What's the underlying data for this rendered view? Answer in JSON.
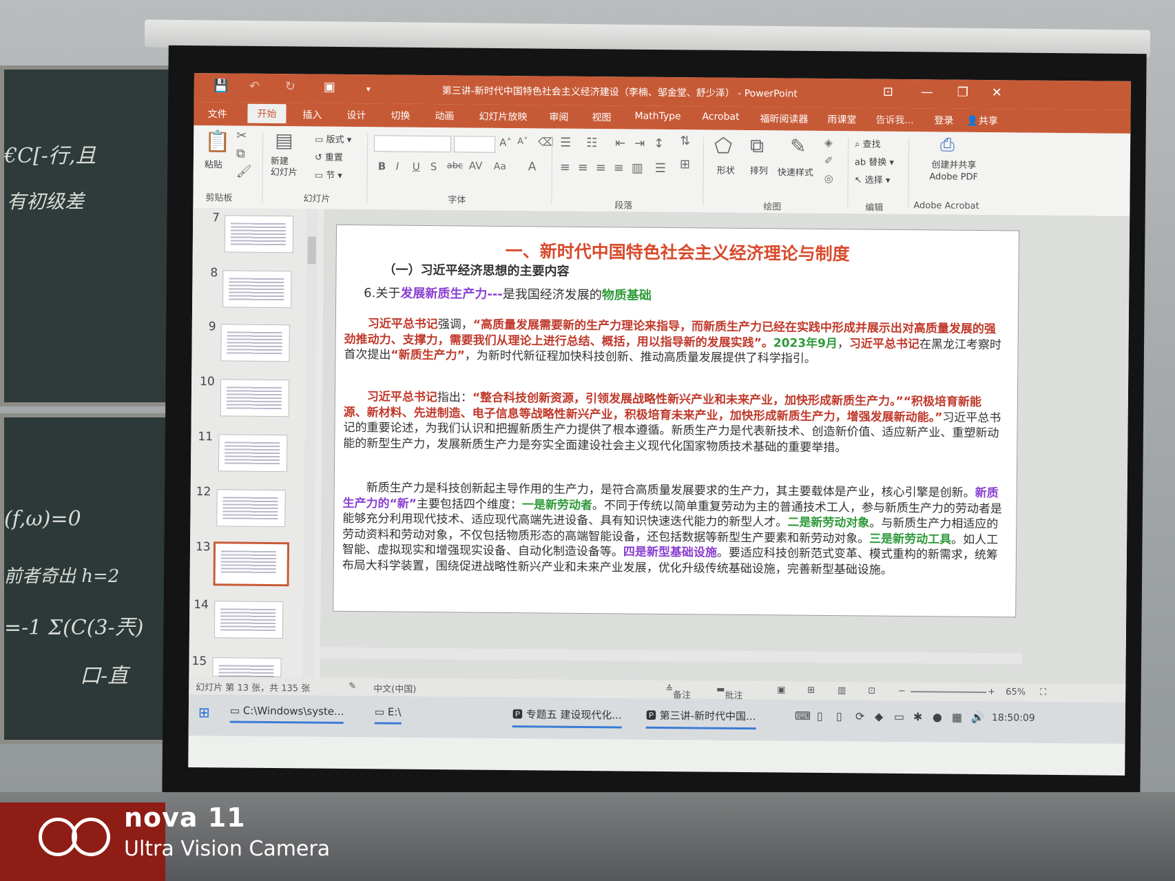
{
  "photo": {
    "camera_brand": "nova 11",
    "camera_sub": "Ultra Vision Camera",
    "chalk_lines": [
      "€C[-行,且",
      "有初级差",
      "(f,ω)=0",
      "前者奇出  h=2",
      "=-1  Σ(C(3-兲)",
      "口-直"
    ]
  },
  "window": {
    "title": "第三讲-新时代中国特色社会主义经济建设（李楠、邹金堂、舒少泽） - PowerPoint",
    "tabs": [
      "文件",
      "开始",
      "插入",
      "设计",
      "切换",
      "动画",
      "幻灯片放映",
      "审阅",
      "视图",
      "MathType",
      "Acrobat",
      "福昕阅读器",
      "雨课堂"
    ],
    "tell_me": "告诉我...",
    "login": "登录",
    "share": "共享"
  },
  "ribbon": {
    "paste": "粘贴",
    "clipboard": "剪贴板",
    "new_slide": "新建\n幻灯片",
    "layout": "版式",
    "reset": "重置",
    "section": "节",
    "slides_group": "幻灯片",
    "font_group": "字体",
    "para_group": "段落",
    "shape": "形状",
    "arrange": "排列",
    "quick_style": "快速样式",
    "draw_group": "绘图",
    "find": "查找",
    "replace": "替换",
    "select": "选择",
    "edit_group": "编辑",
    "create_pdf": "创建并共享\nAdobe PDF",
    "adobe_group": "Adobe Acrobat"
  },
  "thumbnails": [
    "7",
    "8",
    "9",
    "10",
    "11",
    "12",
    "13",
    "14",
    "15"
  ],
  "selected_slide": "13",
  "slide": {
    "title": "一、新时代中国特色社会主义经济理论与制度",
    "subtitle": "（一）习近平经济思想的主要内容",
    "point_prefix": "6.关于",
    "point_highlight": "发展新质生产力---",
    "point_mid": "是我国经济发展的",
    "point_end": "物质基础",
    "p1_a": "习近平总书记",
    "p1_b": "强调，",
    "p1_c": "“高质量发展需要新的生产力理论来指导，而新质生产力已经在实践中形成并展示出对高质量发展的强劲推动力、支撑力，需要我们从理论上进行总结、概括，用以指导新的发展实践”。",
    "p1_d": "2023年9月",
    "p1_e": "，",
    "p1_f": "习近平总书记",
    "p1_g": "在黑龙江考察时首次提出",
    "p1_h": "“新质生产力”",
    "p1_i": "，为新时代新征程加快科技创新、推动高质量发展提供了科学指引。",
    "p2_a": "习近平总书记",
    "p2_b": "指出：",
    "p2_c": "“整合科技创新资源，引领发展战略性新兴产业和未来产业，加快形成新质生产力。”“积极培育新能源、新材料、先进制造、电子信息等战略性新兴产业，积极培育未来产业，加快形成新质生产力，增强发展新动能。”",
    "p2_d": "习近平总书记的重要论述，为我们认识和把握新质生产力提供了根本遵循。新质生产力是代表新技术、创造新价值、适应新产业、重塑新动能的新型生产力，发展新质生产力是夯实全面建设社会主义现代化国家物质技术基础的重要举措。",
    "p3_a": "新质生产力是科技创新起主导作用的生产力，是符合高质量发展要求的生产力，其主要载体是产业，核心引擎是创新。",
    "p3_b": "新质生产力的“新”",
    "p3_c": "主要包括四个维度：",
    "p3_d": "一是新劳动者",
    "p3_e": "。不同于传统以简单重复劳动为主的普通技术工人，参与新质生产力的劳动者是能够充分利用现代技术、适应现代高端先进设备、具有知识快速迭代能力的新型人才。",
    "p3_f": "二是新劳动对象",
    "p3_g": "。与新质生产力相适应的劳动资料和劳动对象，不仅包括物质形态的高端智能设备，还包括数据等新型生产要素和新劳动对象。",
    "p3_h": "三是新劳动工具",
    "p3_i": "。如人工智能、虚拟现实和增强现实设备、自动化制造设备等。",
    "p3_j": "四是新型基础设施",
    "p3_k": "。要适应科技创新范式变革、模式重构的新需求，统筹布局大科学装置，围绕促进战略性新兴产业和未来产业发展，优化升级传统基础设施，完善新型基础设施。"
  },
  "status": {
    "slide_count": "幻灯片 第 13 张，共 135 张",
    "language": "中文(中国)",
    "notes": "备注",
    "comments": "批注",
    "zoom": "65%"
  },
  "taskbar": {
    "items": [
      "C:\\Windows\\syste...",
      "E:\\",
      "专题五 建设现代化...",
      "第三讲-新时代中国..."
    ],
    "clock": "18:50:09"
  },
  "colors": {
    "accent": "#c75a36",
    "red": "#c0392b",
    "purple": "#8a3fd1",
    "green": "#2f9a3a"
  }
}
